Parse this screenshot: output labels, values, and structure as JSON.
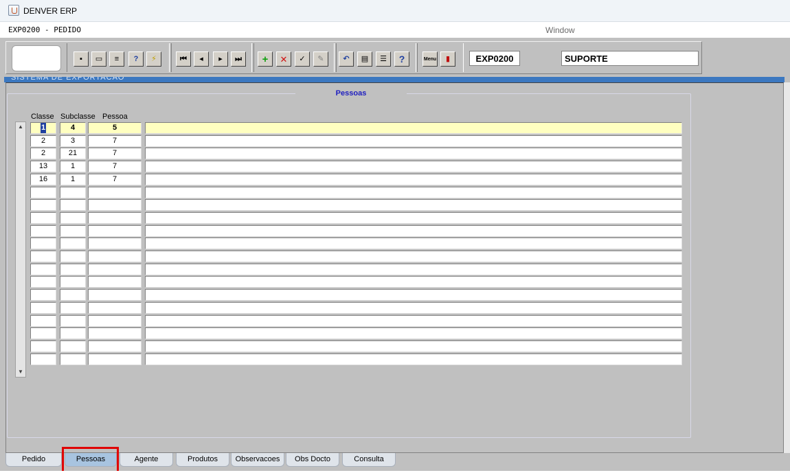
{
  "window": {
    "title": "DENVER ERP",
    "form_title": "EXP0200 - PEDIDO",
    "menu_window": "Window"
  },
  "toolbar": {
    "form_code": "EXP0200",
    "user": "SUPORTE",
    "icons": [
      "save-icon",
      "print-preview-icon",
      "printer-icon",
      "help-query-icon",
      "execute-query-icon",
      "first-record-icon",
      "previous-record-icon",
      "next-record-icon",
      "last-record-icon",
      "add-record-icon",
      "delete-record-icon",
      "record-check-icon",
      "edit-icon",
      "undo-icon",
      "clipboard-icon",
      "list-values-icon",
      "help-icon",
      "menu-icon",
      "exit-icon"
    ]
  },
  "section": {
    "title": "Pessoas"
  },
  "columns": {
    "classe": "Classe",
    "subclasse": "Subclasse",
    "pessoa": "Pessoa"
  },
  "rows": [
    {
      "classe": "1",
      "subclasse": "4",
      "pessoa": "5",
      "descricao": ""
    },
    {
      "classe": "2",
      "subclasse": "3",
      "pessoa": "7",
      "descricao": ""
    },
    {
      "classe": "2",
      "subclasse": "21",
      "pessoa": "7",
      "descricao": ""
    },
    {
      "classe": "13",
      "subclasse": "1",
      "pessoa": "7",
      "descricao": ""
    },
    {
      "classe": "16",
      "subclasse": "1",
      "pessoa": "7",
      "descricao": ""
    }
  ],
  "empty_rows": 14,
  "tabs": [
    "Pedido",
    "Pessoas",
    "Agente",
    "Produtos",
    "Observacoes",
    "Obs Docto",
    "Consulta"
  ],
  "active_tab": "Pessoas",
  "colors": {
    "active_row": "#ffffc0",
    "section_title": "#2020c0",
    "highlight": "#e00000"
  }
}
